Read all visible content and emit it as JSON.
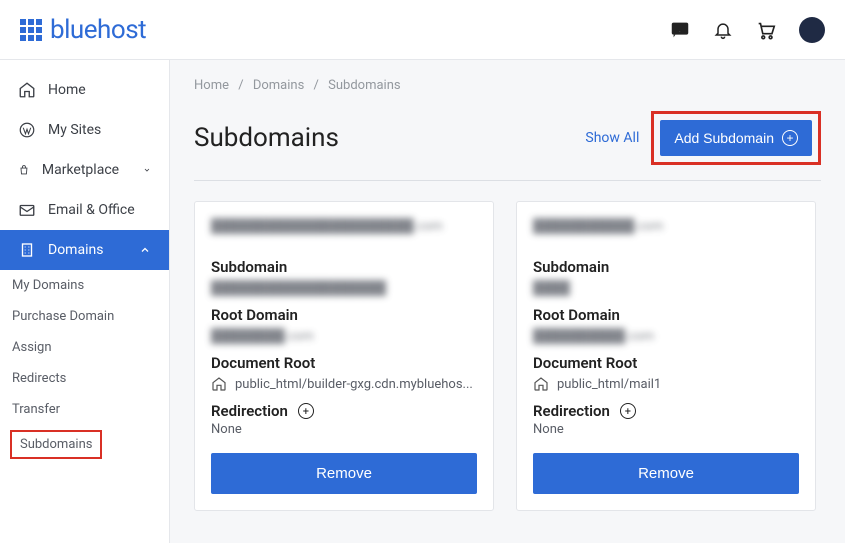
{
  "header": {
    "brand": "bluehost"
  },
  "sidebar": {
    "items": [
      {
        "label": "Home"
      },
      {
        "label": "My Sites"
      },
      {
        "label": "Marketplace"
      },
      {
        "label": "Email & Office"
      },
      {
        "label": "Domains"
      }
    ],
    "sub": [
      {
        "label": "My Domains"
      },
      {
        "label": "Purchase Domain"
      },
      {
        "label": "Assign"
      },
      {
        "label": "Redirects"
      },
      {
        "label": "Transfer"
      },
      {
        "label": "Subdomains"
      }
    ]
  },
  "breadcrumb": {
    "home": "Home",
    "domains": "Domains",
    "current": "Subdomains"
  },
  "page": {
    "title": "Subdomains",
    "show_all": "Show All",
    "add_btn": "Add Subdomain"
  },
  "labels": {
    "subdomain": "Subdomain",
    "root_domain": "Root Domain",
    "document_root": "Document Root",
    "redirection": "Redirection",
    "remove": "Remove"
  },
  "cards": [
    {
      "domain": "██████████████████████.com",
      "subdomain": "███████████████████",
      "root_domain": "████████.com",
      "document_root": "public_html/builder-gxg.cdn.mybluehos...",
      "redirection": "None"
    },
    {
      "domain": "███████████.com",
      "subdomain": "████",
      "root_domain": "██████████.com",
      "document_root": "public_html/mail1",
      "redirection": "None"
    }
  ]
}
